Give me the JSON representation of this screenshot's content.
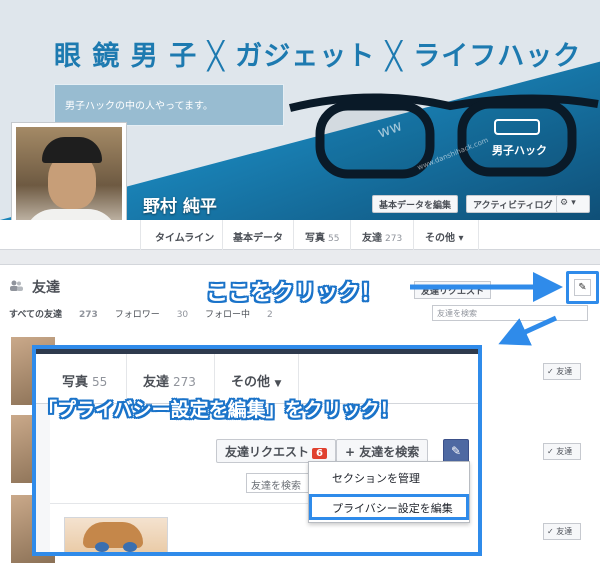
{
  "cover": {
    "title": "眼 鏡 男 子 ╳ ガジェット ╳ ライフハック",
    "subtitle": "男子ハックの中の人やってます。",
    "watermark": "www.danshihack.com",
    "glasses_label": "男子ハック"
  },
  "profile": {
    "name": "野村 純平",
    "about_button": "基本データを編集",
    "activity_button": "アクティビティログ",
    "gear_button": "⚙ ▾"
  },
  "tabs": {
    "timeline": "タイムライン",
    "about": "基本データ",
    "photos": "写真",
    "photos_count": "55",
    "friends": "友達",
    "friends_count": "273",
    "more": "その他 ▾"
  },
  "friends_panel": {
    "title": "友達",
    "all_friends": "すべての友達",
    "all_friends_count": "273",
    "followers": "フォロワー",
    "followers_count": "30",
    "following": "フォロー中",
    "following_count": "2",
    "request_button": "友達リクエスト",
    "search_placeholder": "友達を検索",
    "friend_button": "✓ 友達"
  },
  "annotation": {
    "click_here": "ここをクリック！",
    "caption": "「プライバシー設定を編集」をクリック！"
  },
  "zoom": {
    "photos": "写真",
    "photos_count": "55",
    "friends": "友達",
    "friends_count": "273",
    "more": "その他",
    "request_button": "友達リクエスト",
    "request_badge": "6",
    "find_button": "+ 友達を検索",
    "search_placeholder": "友達を検索",
    "menu_manage": "セクションを管理",
    "menu_privacy": "プライバシー設定を編集"
  },
  "colors": {
    "highlight": "#2f8bea",
    "facebook_blue": "#4e69a2",
    "badge_red": "#e0412f"
  }
}
